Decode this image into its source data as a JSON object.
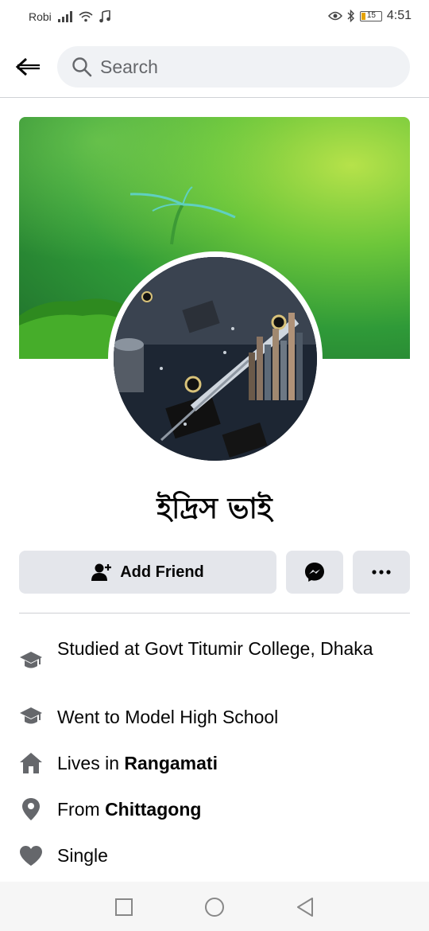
{
  "status_bar": {
    "carrier": "Robi",
    "time": "4:51",
    "battery": "15",
    "icons": [
      "signal-icon",
      "wifi-icon",
      "music-icon",
      "eye-icon",
      "bluetooth-icon",
      "battery-icon"
    ]
  },
  "header": {
    "back_icon": "back-arrow-icon",
    "search_placeholder": "Search",
    "search_icon": "search-icon"
  },
  "profile": {
    "name": "ইদ্রিস ভাই"
  },
  "actions": {
    "add_friend_label": "Add Friend",
    "add_friend_icon": "add-friend-icon",
    "messenger_icon": "messenger-icon",
    "more_icon": "more-icon"
  },
  "details": {
    "studied_prefix": "Studied at Govt Titumir College, Dhaka",
    "went_to": "Went to Model High School",
    "lives_prefix": "Lives in ",
    "lives_place": "Rangamati",
    "from_prefix": "From ",
    "from_place": "Chittagong",
    "relationship": "Single"
  },
  "colors": {
    "button_bg": "#e4e6eb",
    "search_bg": "#f0f2f5",
    "icon_gray": "#65676b",
    "text": "#050505"
  },
  "nav": {
    "recent_icon": "square-icon",
    "home_icon": "circle-icon",
    "back_icon": "triangle-back-icon"
  }
}
